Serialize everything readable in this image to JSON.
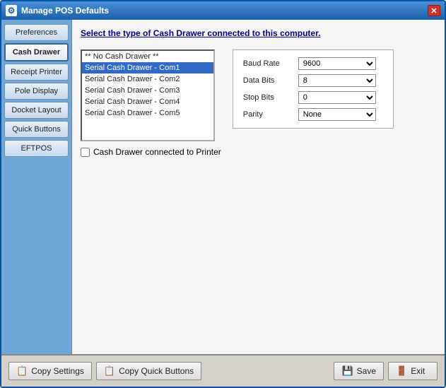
{
  "window": {
    "title": "Manage POS Defaults",
    "icon": "⚙"
  },
  "sidebar": {
    "items": [
      {
        "id": "preferences",
        "label": "Preferences",
        "active": false
      },
      {
        "id": "cash-drawer",
        "label": "Cash Drawer",
        "active": true
      },
      {
        "id": "receipt-printer",
        "label": "Receipt Printer",
        "active": false
      },
      {
        "id": "pole-display",
        "label": "Pole Display",
        "active": false
      },
      {
        "id": "docket-layout",
        "label": "Docket Layout",
        "active": false
      },
      {
        "id": "quick-buttons",
        "label": "Quick Buttons",
        "active": false
      },
      {
        "id": "eftpos",
        "label": "EFTPOS",
        "active": false
      }
    ]
  },
  "content": {
    "title": "Select the type of Cash Drawer connected to this computer.",
    "listbox": {
      "items": [
        {
          "label": "** No Cash Drawer **",
          "selected": false
        },
        {
          "label": "Serial Cash Drawer - Com1",
          "selected": true
        },
        {
          "label": "Serial Cash Drawer - Com2",
          "selected": false
        },
        {
          "label": "Serial Cash Drawer - Com3",
          "selected": false
        },
        {
          "label": "Serial Cash Drawer - Com4",
          "selected": false
        },
        {
          "label": "Serial Cash Drawer - Com5",
          "selected": false
        }
      ]
    },
    "checkbox_label": "Cash Drawer connected to Printer",
    "settings": {
      "baud_rate_label": "Baud Rate",
      "baud_rate_value": "9600",
      "data_bits_label": "Data Bits",
      "data_bits_value": "8",
      "stop_bits_label": "Stop Bits",
      "stop_bits_value": "0",
      "parity_label": "Parity",
      "parity_value": "None"
    }
  },
  "footer": {
    "copy_settings_label": "Copy Settings",
    "copy_quick_buttons_label": "Copy Quick Buttons",
    "save_label": "Save",
    "exit_label": "Exit"
  }
}
